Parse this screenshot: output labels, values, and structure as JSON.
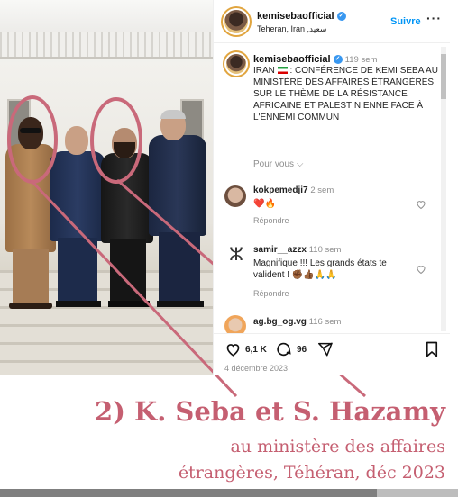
{
  "colors": {
    "accent": "#c55f71",
    "link": "#0095f6",
    "verified": "#3897f0",
    "muted": "#8e8e8e"
  },
  "post": {
    "username": "kemisebaofficial",
    "location": "Teheran, Iran ,سعيد",
    "follow_label": "Suivre",
    "more_icon": "more-dots-icon",
    "caption_user": "kemisebaofficial",
    "caption_age": "119 sem",
    "caption_prefix": "IRAN",
    "caption_text": " : CONFÉRENCE DE KEMI SEBA AU MINISTÈRE DES AFFAIRES ÉTRANGÈRES SUR LE THÈME DE LA RÉSISTANCE AFRICAINE ET PALESTINIENNE FACE À L'ENNEMI COMMUN",
    "see_translation": "Pour vous",
    "comments": [
      {
        "user": "kokpemedji7",
        "age": "2 sem",
        "text": "❤️🔥",
        "reply": "Répondre"
      },
      {
        "user": "samir__azzx",
        "age": "110 sem",
        "text": "Magnifique !!! Les grands états te valident ! ✊🏾👍🏾🙏🙏",
        "reply": "Répondre"
      },
      {
        "user": "ag.bg_og.vg",
        "age": "116 sem"
      }
    ],
    "likes": "6,1 K",
    "comment_count": "96",
    "date": "4 décembre 2023"
  },
  "caption": {
    "title": "2) K. Seba et S. Hazamy",
    "line1": "au ministère des affaires",
    "line2": "étrangères, Téhéran, déc 2023"
  }
}
